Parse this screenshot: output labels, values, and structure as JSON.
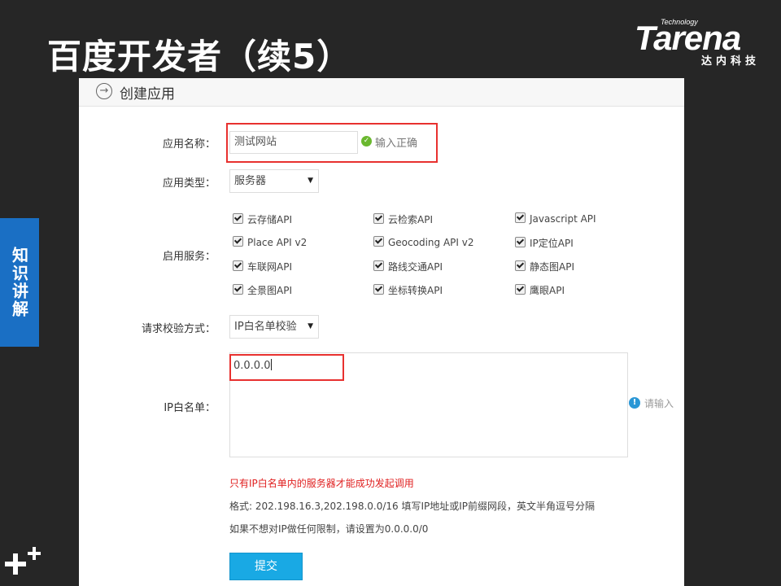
{
  "slide": {
    "title": "百度开发者（续5）",
    "logo_tech": "Technology",
    "logo_name": "Tarena",
    "logo_sub": "达内科技",
    "side_tab": "知识讲解"
  },
  "panel": {
    "header_title": "创建应用",
    "app_name": {
      "label": "应用名称：",
      "value": "测试网站",
      "status": "输入正确"
    },
    "app_type": {
      "label": "应用类型：",
      "value": "服务器"
    },
    "services": {
      "label": "启用服务：",
      "items": [
        {
          "label": "云存储API",
          "checked": true
        },
        {
          "label": "云检索API",
          "checked": true
        },
        {
          "label": "Javascript API",
          "checked": true
        },
        {
          "label": "Place API v2",
          "checked": true
        },
        {
          "label": "Geocoding API v2",
          "checked": true
        },
        {
          "label": "IP定位API",
          "checked": true
        },
        {
          "label": "车联网API",
          "checked": true
        },
        {
          "label": "路线交通API",
          "checked": true
        },
        {
          "label": "静态图API",
          "checked": true
        },
        {
          "label": "全景图API",
          "checked": true
        },
        {
          "label": "坐标转换API",
          "checked": true
        },
        {
          "label": "鹰眼API",
          "checked": true
        }
      ]
    },
    "verify_method": {
      "label": "请求校验方式：",
      "value": "IP白名单校验"
    },
    "ip_whitelist": {
      "label": "IP白名单：",
      "value": "0.0.0.0",
      "hint": "请输入"
    },
    "notes": {
      "warning": "只有IP白名单内的服务器才能成功发起调用",
      "format": "格式: 202.198.16.3,202.198.0.0/16 填写IP地址或IP前缀网段，英文半角逗号分隔",
      "no_limit": "如果不想对IP做任何限制，请设置为0.0.0.0/0"
    },
    "submit_label": "提交"
  }
}
